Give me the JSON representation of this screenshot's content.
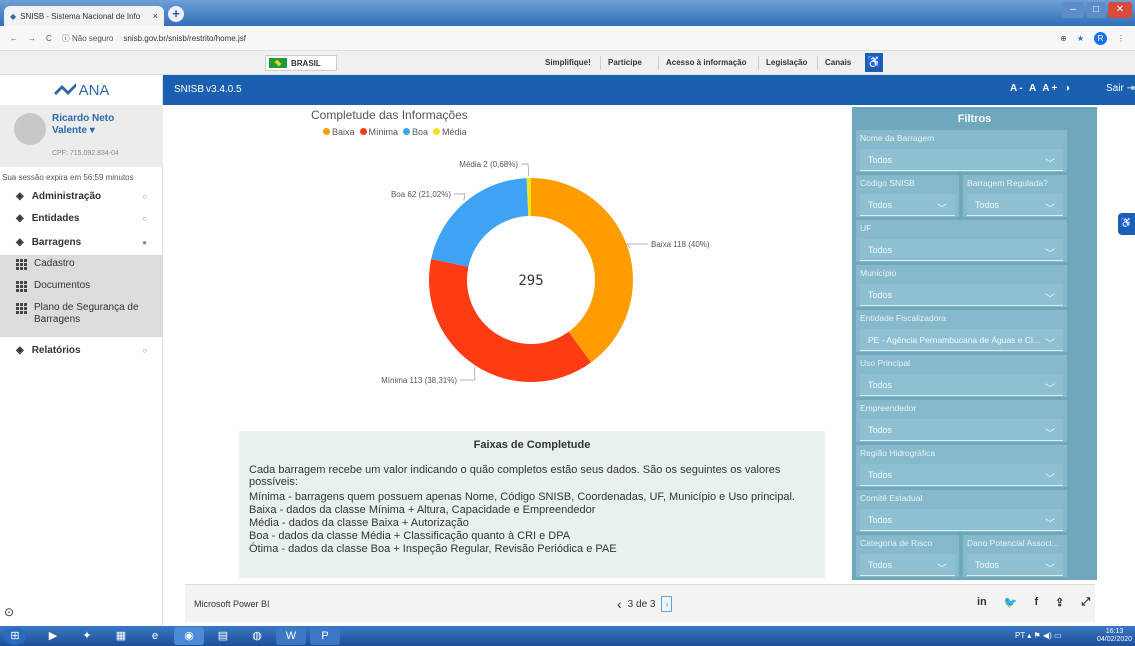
{
  "browser": {
    "tab_title": "SNISB - Sistema Nacional de Info",
    "close": "×",
    "new_tab": "+",
    "security": "ⓘ Não seguro",
    "url": "snisb.gov.br/snisb/restrito/home.jsf",
    "profile": "R"
  },
  "govbar": {
    "brasil": "BRASIL",
    "links": [
      "Simplifique!",
      "Participe",
      "Acesso à informação",
      "Legislação",
      "Canais"
    ]
  },
  "sidebar": {
    "logo": "ANA",
    "user_name": "Ricardo Neto Valente ▾",
    "user_cpf": "CPF: 715.092.834-04",
    "session": "Sua sessão expira em 56:59 minutos",
    "menu": [
      {
        "label": "Administração"
      },
      {
        "label": "Entidades"
      },
      {
        "label": "Barragens"
      }
    ],
    "submenu": [
      "Cadastro",
      "Documentos",
      "Plano de Segurança de Barragens"
    ],
    "reports": "Relatórios"
  },
  "header": {
    "app": "SNISB",
    "version": "v3.4.0.5",
    "font_controls": "A- A A+ ◑",
    "logout": "Sair"
  },
  "chart_data": {
    "type": "pie",
    "title": "Completude das Informações",
    "center_label": "295",
    "slices": [
      {
        "name": "Baixa",
        "value": 118,
        "label": "Baixa 118 (40%)",
        "color": "#ff9c00"
      },
      {
        "name": "Mínima",
        "value": 113,
        "label": "Mínima 113 (38,31%)",
        "color": "#ff3b14"
      },
      {
        "name": "Boa",
        "value": 62,
        "label": "Boa 62 (21,02%)",
        "color": "#3ea3f5"
      },
      {
        "name": "Média",
        "value": 2,
        "label": "Média 2 (0,68%)",
        "color": "#f4e31c"
      }
    ]
  },
  "info": {
    "title": "Faixas de Completude",
    "intro": "Cada barragem recebe um valor indicando o quão completos estão seus dados. São os seguintes os valores possíveis:",
    "lines": [
      "Mínima - barragens quem possuem apenas Nome, Código SNISB, Coordenadas, UF, Município e Uso principal.",
      "Baixa - dados da classe Mínima + Altura, Capacidade e Empreendedor",
      "Média - dados da classe Baixa + Autorização",
      "Boa - dados da classe Média + Classificação quanto à CRI e DPA",
      "Ótima - dados da classe Boa + Inspeção Regular, Revisão Periódica e PAE"
    ]
  },
  "filters": {
    "title": "Filtros",
    "nome_barragem": {
      "label": "Nome da Barragem",
      "value": "Todos"
    },
    "codigo_snisb": {
      "label": "Código SNISB",
      "value": "Todos"
    },
    "barragem_regulada": {
      "label": "Barragem Regulada?",
      "value": "Todos"
    },
    "uf": {
      "label": "UF",
      "value": "Todos"
    },
    "municipio": {
      "label": "Município",
      "value": "Todos"
    },
    "entidade": {
      "label": "Entidade Fiscalizadora",
      "value": "PE - Agência Pernambucana de Águas e Cl..."
    },
    "uso": {
      "label": "Uso Principal",
      "value": "Todos"
    },
    "empreendedor": {
      "label": "Empreendedor",
      "value": "Todos"
    },
    "regiao": {
      "label": "Região Hidrográfica",
      "value": "Todos"
    },
    "comite": {
      "label": "Comitê Estadual",
      "value": "Todos"
    },
    "risco": {
      "label": "Categoria de Risco",
      "value": "Todos"
    },
    "dano": {
      "label": "Dano Potencial Associ...",
      "value": "Todos"
    }
  },
  "powerbi": {
    "name": "Microsoft Power BI",
    "page": "3 de 3",
    "prev": "‹",
    "next": "›"
  },
  "taskbar": {
    "time": "16:13",
    "date": "04/02/2020",
    "lang": "PT"
  }
}
